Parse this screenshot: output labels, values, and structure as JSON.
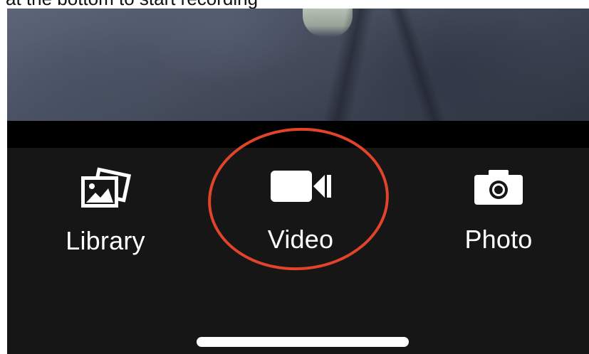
{
  "caption": {
    "text": "at the bottom to start recording"
  },
  "toolbar": {
    "library_label": "Library",
    "video_label": "Video",
    "photo_label": "Photo",
    "library_icon": "photo-library-icon",
    "video_icon": "video-camera-icon",
    "photo_icon": "camera-icon"
  },
  "annotation": {
    "highlight_color": "#e2442b",
    "highlighted_item": "Video"
  },
  "colors": {
    "toolbar_background": "#161616",
    "label_color": "#ffffff"
  }
}
